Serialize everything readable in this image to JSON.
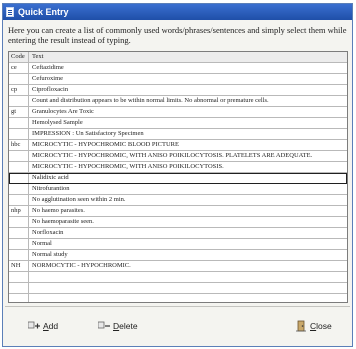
{
  "window": {
    "title": "Quick Entry",
    "description": "Here you can create a list of commonly used words/phrases/sentences and simply select them while entering the result instead of typing."
  },
  "table": {
    "columns": [
      "Code",
      "Text"
    ],
    "rows": [
      {
        "code": "ce",
        "text": "Ceftazidime"
      },
      {
        "code": "",
        "text": "Cefuroxime"
      },
      {
        "code": "cp",
        "text": "Ciprofloxacin"
      },
      {
        "code": "",
        "text": "Count and distribution appears to be within normal limits. No abnormal or premature cells."
      },
      {
        "code": "gt",
        "text": "Granulocytes Are Toxic"
      },
      {
        "code": "",
        "text": "Hemolysed Sample"
      },
      {
        "code": "",
        "text": "IMPRESSION :  Un Satisfactory Specimen"
      },
      {
        "code": "hbc",
        "text": "MICROCYTIC - HYPOCHROMIC BLOOD PICTURE"
      },
      {
        "code": "",
        "text": "MICROCYTIC - HYPOCHROMIC, WITH ANISO POIKILOCYTOSIS.  PLATELETS ARE ADEQUATE."
      },
      {
        "code": "",
        "text": "MICROCYTIC - HYPOCHROMIC, WITH ANISO POIKILOCYTOSIS."
      },
      {
        "code": "",
        "text": "Nalidixic acid"
      },
      {
        "code": "",
        "text": "Nitrofurantion"
      },
      {
        "code": "",
        "text": "No agglutination seen within 2 min."
      },
      {
        "code": "nhp",
        "text": "No haemo parasites."
      },
      {
        "code": "",
        "text": "No haemoparasite seen."
      },
      {
        "code": "",
        "text": "Norfloxacin"
      },
      {
        "code": "",
        "text": "Normal"
      },
      {
        "code": "",
        "text": "Normal study"
      },
      {
        "code": "NH",
        "text": "NORMOCYTIC - HYPOCHROMIC."
      },
      {
        "code": "",
        "text": ""
      },
      {
        "code": "",
        "text": ""
      },
      {
        "code": "",
        "text": ""
      },
      {
        "code": "",
        "text": ""
      }
    ],
    "selected_row_index": 10
  },
  "buttons": {
    "add": {
      "hotkey": "A",
      "rest": "dd"
    },
    "delete": {
      "hotkey": "D",
      "rest": "elete"
    },
    "close": {
      "hotkey": "C",
      "rest": "lose"
    }
  }
}
